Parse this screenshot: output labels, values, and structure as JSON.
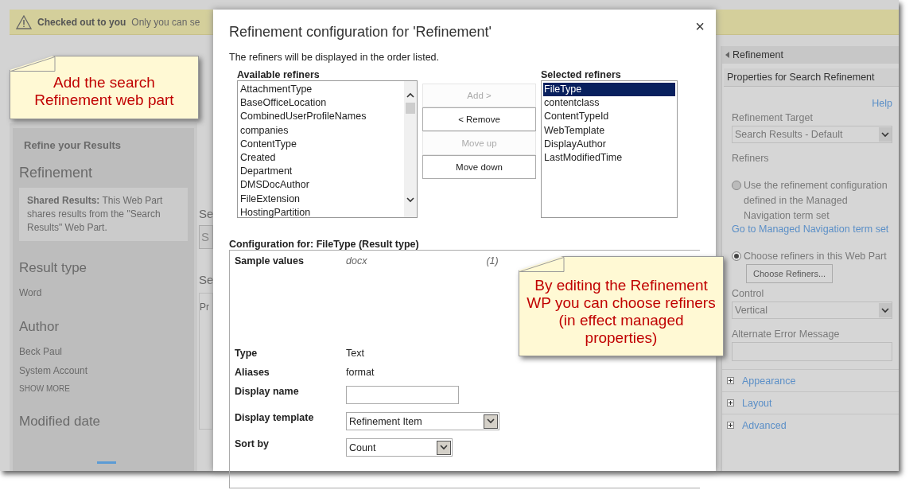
{
  "banner": {
    "title": "Checked out to you",
    "message": "Only you can se"
  },
  "left_panel": {
    "heading": "Refine your Results",
    "title": "Refinement",
    "notice": "**Shared Results:** This Web Part shares results from the \"Search Results\" Web Part.",
    "groups": [
      {
        "title": "Result type",
        "items": [
          "Word"
        ]
      },
      {
        "title": "Author",
        "items": [
          "Beck Paul",
          "System Account"
        ],
        "more": "SHOW MORE"
      },
      {
        "title": "Modified date"
      }
    ]
  },
  "column_2": {
    "heading_1": "Se",
    "search_box": "S",
    "heading_2": "Se",
    "tab": "Pr"
  },
  "dialog": {
    "title": "Refinement configuration for 'Refinement'",
    "close": "×",
    "intro": "The refiners will be displayed in the order listed.",
    "available": {
      "label": "Available refiners",
      "items": [
        "AttachmentType",
        "BaseOfficeLocation",
        "CombinedUserProfileNames",
        "companies",
        "ContentType",
        "Created",
        "Department",
        "DMSDocAuthor",
        "FileExtension",
        "HostingPartition"
      ]
    },
    "buttons": [
      {
        "label": "Add >",
        "disabled": true
      },
      {
        "label": "< Remove",
        "disabled": false
      },
      {
        "label": "Move up",
        "disabled": true
      },
      {
        "label": "Move down",
        "disabled": false
      }
    ],
    "selected_refiners": {
      "label": "Selected refiners",
      "items": [
        {
          "label": "FileType",
          "selected": true
        },
        {
          "label": "contentclass",
          "selected": false
        },
        {
          "label": "ContentTypeId",
          "selected": false
        },
        {
          "label": "WebTemplate",
          "selected": false
        },
        {
          "label": "DisplayAuthor",
          "selected": false
        },
        {
          "label": "LastModifiedTime",
          "selected": false
        }
      ]
    },
    "config": {
      "heading": "Configuration for: FileType (Result type)",
      "sample": {
        "label": "Sample values",
        "value": "docx",
        "count": "(1)"
      },
      "fields": [
        {
          "kind": "text",
          "label": "Type",
          "value": "Text"
        },
        {
          "kind": "text",
          "label": "Aliases",
          "value": "format"
        },
        {
          "kind": "input",
          "label": "Display name"
        },
        {
          "kind": "select",
          "label": "Display template",
          "value": "Refinement Item"
        },
        {
          "kind": "select",
          "label": "Sort by",
          "value": "Count"
        }
      ]
    }
  },
  "tool_pane": {
    "title": "Refinement",
    "subtitle": "Properties for Search Refinement",
    "help": "Help",
    "target_label": "Refinement Target",
    "target_value": "Search Results - Default",
    "refiners_label": "Refiners",
    "options": [
      {
        "label": "Use the refinement configuration defined in the Managed Navigation term set",
        "selected": false,
        "link": "Go to Managed Navigation term set"
      },
      {
        "label": "Choose refiners in this Web Part",
        "selected": true,
        "button": "Choose Refiners..."
      }
    ],
    "control_label": "Control",
    "control_value": "Vertical",
    "error_label": "Alternate Error Message",
    "sections": [
      "Appearance",
      "Layout",
      "Advanced"
    ]
  },
  "callouts": [
    {
      "text": "Add the search Refinement web part"
    },
    {
      "text": "By editing the Refinement WP you can choose refiners (in effect managed properties)"
    }
  ]
}
